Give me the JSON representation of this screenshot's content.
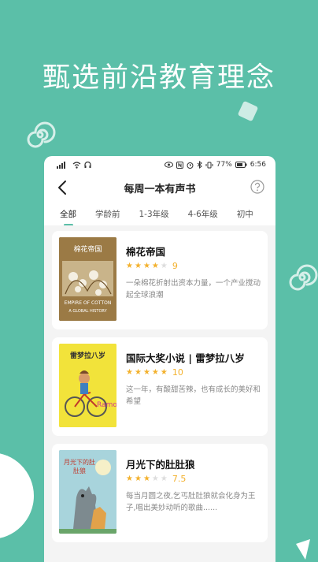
{
  "headline": "甄选前沿教育理念",
  "statusbar": {
    "time": "6:56",
    "battery": "77%"
  },
  "navbar": {
    "title": "每周一本有声书"
  },
  "tabs": [
    {
      "label": "全部",
      "active": true
    },
    {
      "label": "学龄前",
      "active": false
    },
    {
      "label": "1-3年级",
      "active": false
    },
    {
      "label": "4-6年级",
      "active": false
    },
    {
      "label": "初中",
      "active": false
    }
  ],
  "books": [
    {
      "title": "棉花帝国",
      "stars": 4,
      "rating": "9",
      "desc": "一朵棉花折射出资本力量，一个产业搅动起全球浪潮",
      "cover_title": "棉花帝国",
      "cover_en": "EMPIRE OF COTTON",
      "cover_sub": "A GLOBAL HISTORY"
    },
    {
      "title": "国际大奖小说 | 雷梦拉八岁",
      "stars": 5,
      "rating": "10",
      "desc": "这一年，有酸甜苦辣，也有成长的美好和希望",
      "cover_title": "雷梦拉八岁"
    },
    {
      "title": "月光下的肚肚狼",
      "stars": 3,
      "rating": "7.5",
      "desc": "每当月圆之夜,乞丐肚肚狼就会化身为王子,唱出美妙动听的歌曲......",
      "cover_title": "月光下的肚肚狼"
    }
  ],
  "colors": {
    "accent": "#5bbfa8",
    "star": "#f3b12d"
  }
}
